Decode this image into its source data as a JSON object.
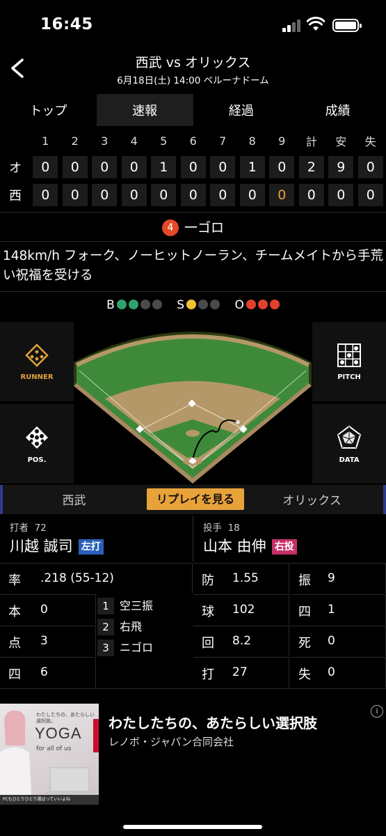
{
  "status_bar": {
    "time": "16:45"
  },
  "header": {
    "title": "西武 vs オリックス",
    "subtitle": "6月18日(土) 14:00 ベルーナドーム"
  },
  "tabs": [
    {
      "label": "トップ"
    },
    {
      "label": "速報"
    },
    {
      "label": "経過"
    },
    {
      "label": "成績"
    }
  ],
  "scoreboard": {
    "headers": [
      "1",
      "2",
      "3",
      "4",
      "5",
      "6",
      "7",
      "8",
      "9",
      "計",
      "安",
      "失"
    ],
    "rows": [
      {
        "team": "オ",
        "cells": [
          "0",
          "0",
          "0",
          "0",
          "1",
          "0",
          "0",
          "1",
          "0",
          "2",
          "9",
          "0"
        ]
      },
      {
        "team": "西",
        "cells": [
          "0",
          "0",
          "0",
          "0",
          "0",
          "0",
          "0",
          "0",
          "0",
          "0",
          "0",
          "0"
        ]
      }
    ]
  },
  "play": {
    "number": "4",
    "result": "一ゴロ",
    "description": "148km/h フォーク、ノーヒットノーラン、チームメイトから手荒い祝福を受ける"
  },
  "count": {
    "b_label": "B",
    "balls": 2,
    "ball_max": 4,
    "s_label": "S",
    "strikes": 1,
    "strike_max": 3,
    "o_label": "O",
    "outs": 3,
    "out_max": 3,
    "colors": {
      "ball": "#2fa36b",
      "strike": "#f2c230",
      "out": "#e2412c",
      "empty": "#4a4a4a"
    }
  },
  "side_buttons": {
    "runner": "RUNNER",
    "pos": "POS.",
    "pitch": "PITCH",
    "data": "DATA"
  },
  "team_bar": {
    "home": "西武",
    "replay": "リプレイを見る",
    "away": "オリックス"
  },
  "batter": {
    "pos_label": "打者",
    "number": "72",
    "name": "川越 誠司",
    "badge": "左打"
  },
  "pitcher": {
    "pos_label": "投手",
    "number": "18",
    "name": "山本 由伸",
    "badge": "右投"
  },
  "batter_stats": {
    "avg_label": "率",
    "avg": ".218 (55-12)",
    "hr_label": "本",
    "hr": "0",
    "rbi_label": "点",
    "rbi": "3",
    "bb_label": "四",
    "bb": "6"
  },
  "at_bats": [
    {
      "n": "1",
      "result": "空三振"
    },
    {
      "n": "2",
      "result": "右飛"
    },
    {
      "n": "3",
      "result": "ニゴロ"
    }
  ],
  "pitcher_stats": {
    "era_label": "防",
    "era": "1.55",
    "so_label": "振",
    "so": "9",
    "pitches_label": "球",
    "pitches": "102",
    "bb_label": "四",
    "bb": "1",
    "ip_label": "回",
    "ip": "8.2",
    "hbp_label": "死",
    "hbp": "0",
    "bf_label": "打",
    "bf": "27",
    "er_label": "失",
    "er": "0"
  },
  "ad": {
    "title": "わたしたちの、あたらしい選択肢",
    "company": "レノボ・ジャパン合同会社",
    "brand": "YOGA",
    "tagline": "for all of us",
    "small_text": "わたしたちの、あたらしい選択肢。",
    "lenovo": "Lenovo",
    "footer": "PCもひとりひとり選ばっていいよね",
    "info": "i"
  }
}
